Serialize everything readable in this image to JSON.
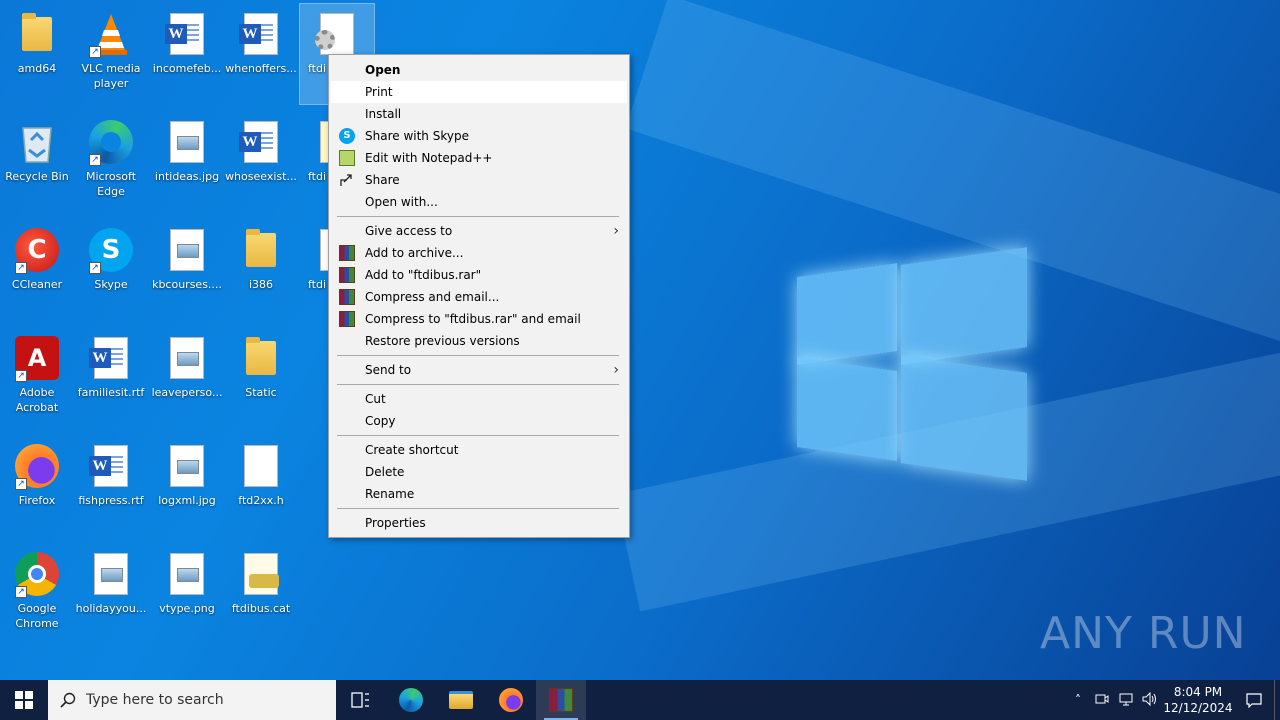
{
  "desktop_icons": [
    {
      "label": "amd64"
    },
    {
      "label": "VLC media player"
    },
    {
      "label": "incomefeb..."
    },
    {
      "label": "whenoffers..."
    },
    {
      "label": "ftdi"
    },
    {
      "label": "Recycle Bin"
    },
    {
      "label": "Microsoft Edge"
    },
    {
      "label": "intideas.jpg"
    },
    {
      "label": "whoseexist..."
    },
    {
      "label": "ftdi"
    },
    {
      "label": "CCleaner"
    },
    {
      "label": "Skype"
    },
    {
      "label": "kbcourses...."
    },
    {
      "label": "i386"
    },
    {
      "label": "ftdi"
    },
    {
      "label": "Adobe Acrobat"
    },
    {
      "label": "familiesit.rtf"
    },
    {
      "label": "leaveperso..."
    },
    {
      "label": "Static"
    },
    {
      "label": "Firefox"
    },
    {
      "label": "fishpress.rtf"
    },
    {
      "label": "logxml.jpg"
    },
    {
      "label": "ftd2xx.h"
    },
    {
      "label": "Google Chrome"
    },
    {
      "label": "holidayyou..."
    },
    {
      "label": "vtype.png"
    },
    {
      "label": "ftdibus.cat"
    }
  ],
  "context_menu": {
    "items": [
      {
        "label": "Open"
      },
      {
        "label": "Print"
      },
      {
        "label": "Install"
      },
      {
        "label": "Share with Skype",
        "icon": "skype-icon"
      },
      {
        "label": "Edit with Notepad++",
        "icon": "notepadpp-icon"
      },
      {
        "label": "Share",
        "icon": "share-icon"
      },
      {
        "label": "Open with..."
      },
      {
        "label": "Give access to"
      },
      {
        "label": "Add to archive...",
        "icon": "winrar-icon"
      },
      {
        "label": "Add to \"ftdibus.rar\"",
        "icon": "winrar-icon"
      },
      {
        "label": "Compress and email...",
        "icon": "winrar-icon"
      },
      {
        "label": "Compress to \"ftdibus.rar\" and email",
        "icon": "winrar-icon"
      },
      {
        "label": "Restore previous versions"
      },
      {
        "label": "Send to"
      },
      {
        "label": "Cut"
      },
      {
        "label": "Copy"
      },
      {
        "label": "Create shortcut"
      },
      {
        "label": "Delete"
      },
      {
        "label": "Rename"
      },
      {
        "label": "Properties"
      }
    ]
  },
  "taskbar": {
    "search_placeholder": "Type here to search",
    "time": "8:04 PM",
    "date": "12/12/2024"
  },
  "watermark": "ANY RUN",
  "colors": {
    "desktop_bg": "#0a84e0",
    "taskbar_bg": "#102040",
    "menu_bg": "#f2f2f2"
  }
}
